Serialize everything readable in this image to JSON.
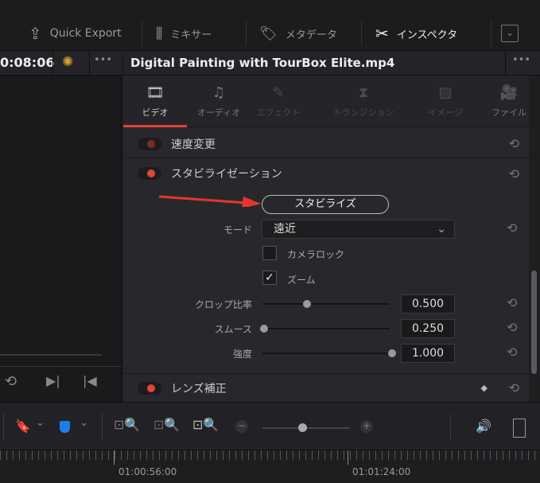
{
  "toolbar": {
    "quick_export": "Quick Export",
    "mixer": "ミキサー",
    "metadata": "メタデータ",
    "inspector": "インスペクタ"
  },
  "viewer": {
    "timecode": "0:08:06"
  },
  "inspector": {
    "clip_title": "Digital Painting with TourBox Elite.mp4",
    "tabs": [
      {
        "label": "ビデオ",
        "active": true
      },
      {
        "label": "オーディオ"
      },
      {
        "label": "エフェクト"
      },
      {
        "label": "トランジション"
      },
      {
        "label": "イメージ"
      },
      {
        "label": "ファイル"
      }
    ],
    "speed_change": "速度変更",
    "stabilization": {
      "title": "スタビライゼーション",
      "button": "スタビライズ",
      "mode_label": "モード",
      "mode_value": "遠近",
      "camera_lock": "カメラロック",
      "camera_lock_checked": false,
      "zoom": "ズーム",
      "zoom_checked": true,
      "crop_ratio_label": "クロップ比率",
      "crop_ratio": "0.500",
      "smooth_label": "スムース",
      "smooth": "0.250",
      "strength_label": "強度",
      "strength": "1.000"
    },
    "lens_correction": "レンズ補正"
  },
  "timeline": {
    "ticks": [
      "01:00:56:00",
      "01:01:24:00"
    ]
  },
  "colors": {
    "accent": "#e0443a",
    "flag_blue": "#1a7fe8",
    "arrow": "#e8352b"
  }
}
